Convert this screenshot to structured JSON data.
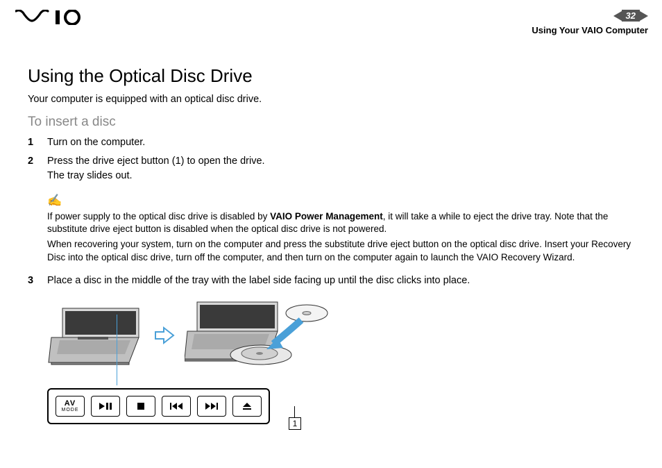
{
  "header": {
    "page_number": "32",
    "breadcrumb": "Using Your VAIO Computer"
  },
  "title": "Using the Optical Disc Drive",
  "intro": "Your computer is equipped with an optical disc drive.",
  "subtitle": "To insert a disc",
  "steps": {
    "s1_num": "1",
    "s1_text": "Turn on the computer.",
    "s2_num": "2",
    "s2_text_a": "Press the drive eject button (1) to open the drive.",
    "s2_text_b": "The tray slides out.",
    "s3_num": "3",
    "s3_text": "Place a disc in the middle of the tray with the label side facing up until the disc clicks into place."
  },
  "note": {
    "p1_a": "If power supply to the optical disc drive is disabled by ",
    "p1_bold": "VAIO Power Management",
    "p1_b": ", it will take a while to eject the drive tray. Note that the substitute drive eject button is disabled when the optical disc drive is not powered.",
    "p2": "When recovering your system, turn on the computer and press the substitute drive eject button on the optical disc drive. Insert your Recovery Disc into the optical disc drive, turn off the computer, and then turn on the computer again to launch the VAIO Recovery Wizard."
  },
  "buttons": {
    "av_top": "AV",
    "av_bottom": "MODE"
  },
  "callout": "1"
}
